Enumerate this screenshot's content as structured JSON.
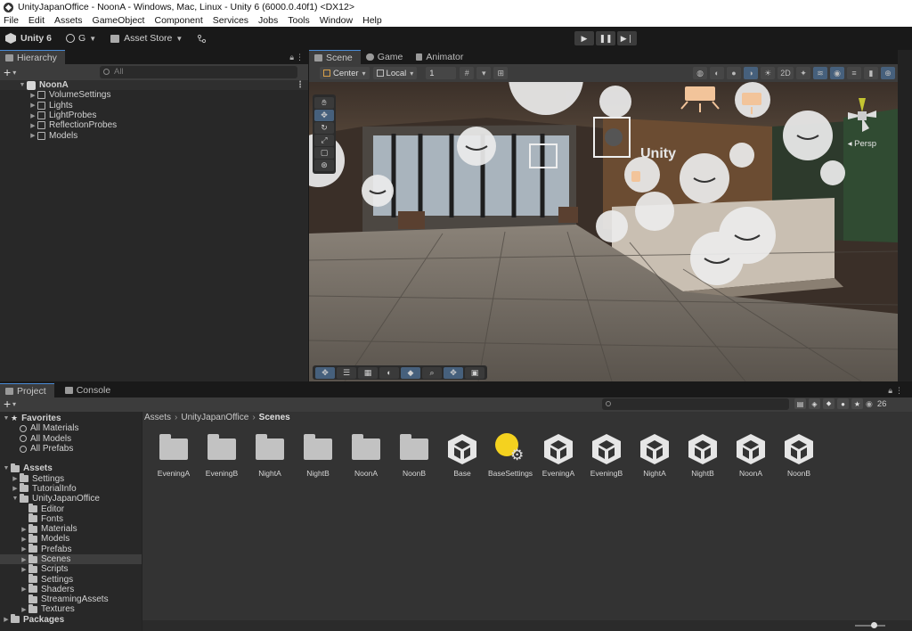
{
  "window": {
    "title": "UnityJapanOffice - NoonA - Windows, Mac, Linux - Unity 6 (6000.0.40f1) <DX12>"
  },
  "menu": [
    "File",
    "Edit",
    "Assets",
    "GameObject",
    "Component",
    "Services",
    "Jobs",
    "Tools",
    "Window",
    "Help"
  ],
  "toolbar": {
    "unity_label": "Unity 6",
    "account_label": "G",
    "store_label": "Asset Store"
  },
  "hierarchy": {
    "tab_label": "Hierarchy",
    "search_placeholder": "All",
    "scene_name": "NoonA",
    "children": [
      "VolumeSettings",
      "Lights",
      "LightProbes",
      "ReflectionProbes",
      "Models"
    ]
  },
  "scene_panel": {
    "tabs": [
      "Scene",
      "Game",
      "Animator"
    ],
    "pivot_mode": "Center",
    "pivot_space": "Local",
    "grid_snap": "1",
    "mode_2d": "2D",
    "camera_label": "Persp"
  },
  "project": {
    "tabs": [
      "Project",
      "Console"
    ],
    "favorites_label": "Favorites",
    "favorites": [
      "All Materials",
      "All Models",
      "All Prefabs"
    ],
    "assets_label": "Assets",
    "assets_children": [
      "Settings",
      "TutorialInfo",
      "UnityJapanOffice"
    ],
    "office_children": [
      "Editor",
      "Fonts",
      "Materials",
      "Models",
      "Prefabs",
      "Scenes",
      "Scripts",
      "Settings",
      "Shaders",
      "StreamingAssets",
      "Textures"
    ],
    "packages_label": "Packages",
    "breadcrumb": [
      "Assets",
      "UnityJapanOffice",
      "Scenes"
    ],
    "visible_count": "26",
    "items": [
      {
        "name": "EveningA",
        "kind": "folder"
      },
      {
        "name": "EveningB",
        "kind": "folder"
      },
      {
        "name": "NightA",
        "kind": "folder"
      },
      {
        "name": "NightB",
        "kind": "folder"
      },
      {
        "name": "NoonA",
        "kind": "folder"
      },
      {
        "name": "NoonB",
        "kind": "folder"
      },
      {
        "name": "Base",
        "kind": "scene"
      },
      {
        "name": "BaseSettings",
        "kind": "lighting-settings"
      },
      {
        "name": "EveningA",
        "kind": "scene"
      },
      {
        "name": "EveningB",
        "kind": "scene"
      },
      {
        "name": "NightA",
        "kind": "scene"
      },
      {
        "name": "NightB",
        "kind": "scene"
      },
      {
        "name": "NoonA",
        "kind": "scene"
      },
      {
        "name": "NoonB",
        "kind": "scene"
      }
    ]
  }
}
